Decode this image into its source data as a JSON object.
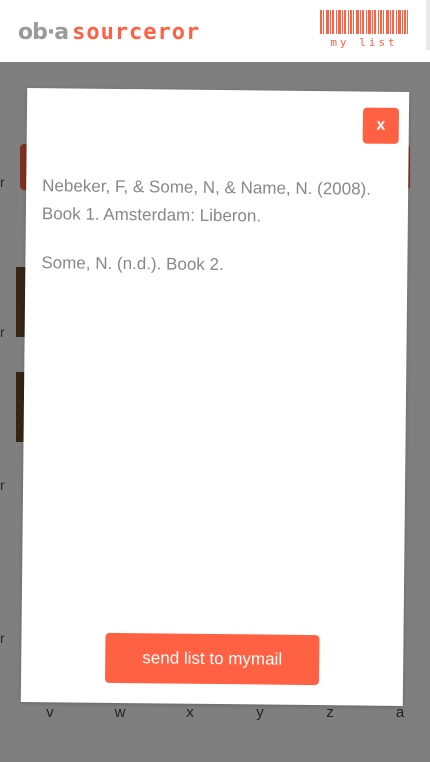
{
  "header": {
    "logo_mark": "ob·a",
    "logo_word": "sourceror",
    "mylist_label": "my list"
  },
  "background": {
    "alphabet": [
      "v",
      "w",
      "x",
      "y",
      "z",
      "a"
    ],
    "side_letter": "r"
  },
  "modal": {
    "close_label": "x",
    "citations": [
      "Nebeker, F, & Some, N, & Name, N. (2008). Book 1. Amsterdam: Liberon.",
      "Some, N. (n.d.). Book 2."
    ],
    "send_label": "send list to mymail"
  },
  "colors": {
    "accent": "#ff6142",
    "overlay": "rgba(0,0,0,0.5)",
    "citation_text": "#888888"
  }
}
